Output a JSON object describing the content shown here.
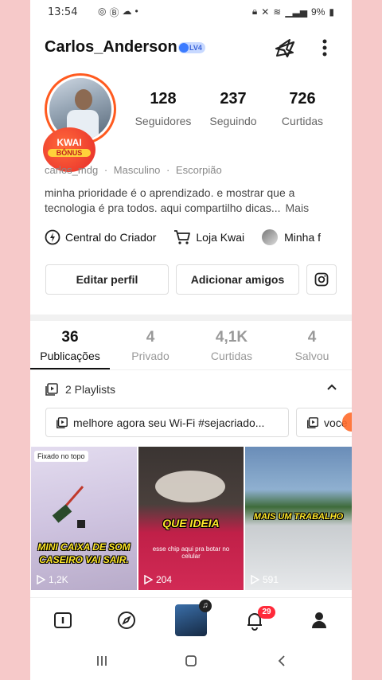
{
  "status": {
    "time": "13:54",
    "battery": "9%"
  },
  "header": {
    "username": "Carlos_Anderson",
    "level": "LV4"
  },
  "avatar_badge": {
    "line1": "KWAI",
    "line2": "BÔNUS"
  },
  "stats": [
    {
      "value": "128",
      "label": "Seguidores"
    },
    {
      "value": "237",
      "label": "Seguindo"
    },
    {
      "value": "726",
      "label": "Curtidas"
    }
  ],
  "meta": {
    "handle": "carlos_mdg",
    "gender": "Masculino",
    "sign": "Escorpião"
  },
  "bio": {
    "text": "minha prioridade é o aprendizado. e mostrar que a tecnologia é pra todos. aqui compartilho dicas...",
    "more": "Mais"
  },
  "shortcuts": {
    "creator": "Central do Criador",
    "shop": "Loja Kwai",
    "mine": "Minha f"
  },
  "buttons": {
    "edit": "Editar perfil",
    "add_friends": "Adicionar amigos"
  },
  "tabs": [
    {
      "count": "36",
      "label": "Publicações"
    },
    {
      "count": "4",
      "label": "Privado"
    },
    {
      "count": "4,1K",
      "label": "Curtidas"
    },
    {
      "count": "4",
      "label": "Salvou"
    }
  ],
  "playlists": {
    "label": "2 Playlists",
    "items": [
      "melhore agora seu Wi-Fi #sejacriado...",
      "voce"
    ]
  },
  "posts": [
    {
      "pinned": "Fixado no topo",
      "caption": "MINI CAIXA DE SOM CASEIRO VAI SAIR.",
      "views": "1,2K"
    },
    {
      "caption": "QUE IDEIA",
      "subtext": "esse chip aqui pra botar no celular",
      "views": "204"
    },
    {
      "caption": "MAIS UM TRABALHO",
      "views": "591"
    }
  ],
  "nav": {
    "notifications": "29"
  }
}
